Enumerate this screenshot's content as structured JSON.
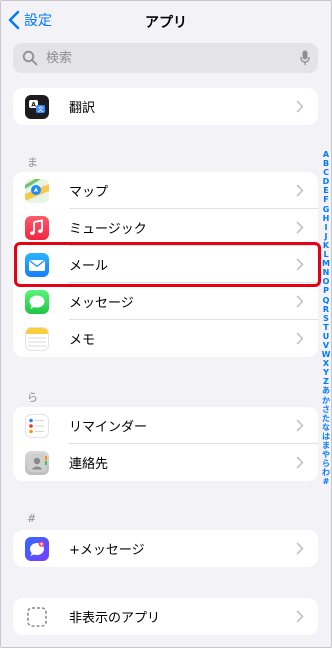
{
  "header": {
    "back_label": "設定",
    "title": "アプリ"
  },
  "search": {
    "placeholder": "検索"
  },
  "groups": [
    {
      "items": [
        {
          "label": "翻訳",
          "icon": "translate-icon"
        }
      ]
    },
    {
      "section": "ま",
      "items": [
        {
          "label": "マップ",
          "icon": "maps-icon"
        },
        {
          "label": "ミュージック",
          "icon": "music-icon"
        },
        {
          "label": "メール",
          "icon": "mail-icon",
          "highlighted": true
        },
        {
          "label": "メッセージ",
          "icon": "messages-icon"
        },
        {
          "label": "メモ",
          "icon": "notes-icon"
        }
      ]
    },
    {
      "section": "ら",
      "items": [
        {
          "label": "リマインダー",
          "icon": "reminders-icon"
        },
        {
          "label": "連絡先",
          "icon": "contacts-icon"
        }
      ]
    },
    {
      "section": "#",
      "items": [
        {
          "label": "+メッセージ",
          "icon": "plus-message-icon"
        }
      ]
    },
    {
      "items": [
        {
          "label": "非表示のアプリ",
          "icon": "hidden-apps-icon"
        }
      ]
    }
  ],
  "index_letters": [
    "A",
    "B",
    "C",
    "D",
    "E",
    "F",
    "G",
    "H",
    "I",
    "J",
    "K",
    "L",
    "M",
    "N",
    "O",
    "P",
    "Q",
    "R",
    "S",
    "T",
    "U",
    "V",
    "W",
    "X",
    "Y",
    "Z",
    "あ",
    "か",
    "さ",
    "た",
    "な",
    "は",
    "ま",
    "や",
    "ら",
    "わ",
    "#"
  ],
  "colors": {
    "accent": "#007aff",
    "highlight": "#e50012"
  }
}
